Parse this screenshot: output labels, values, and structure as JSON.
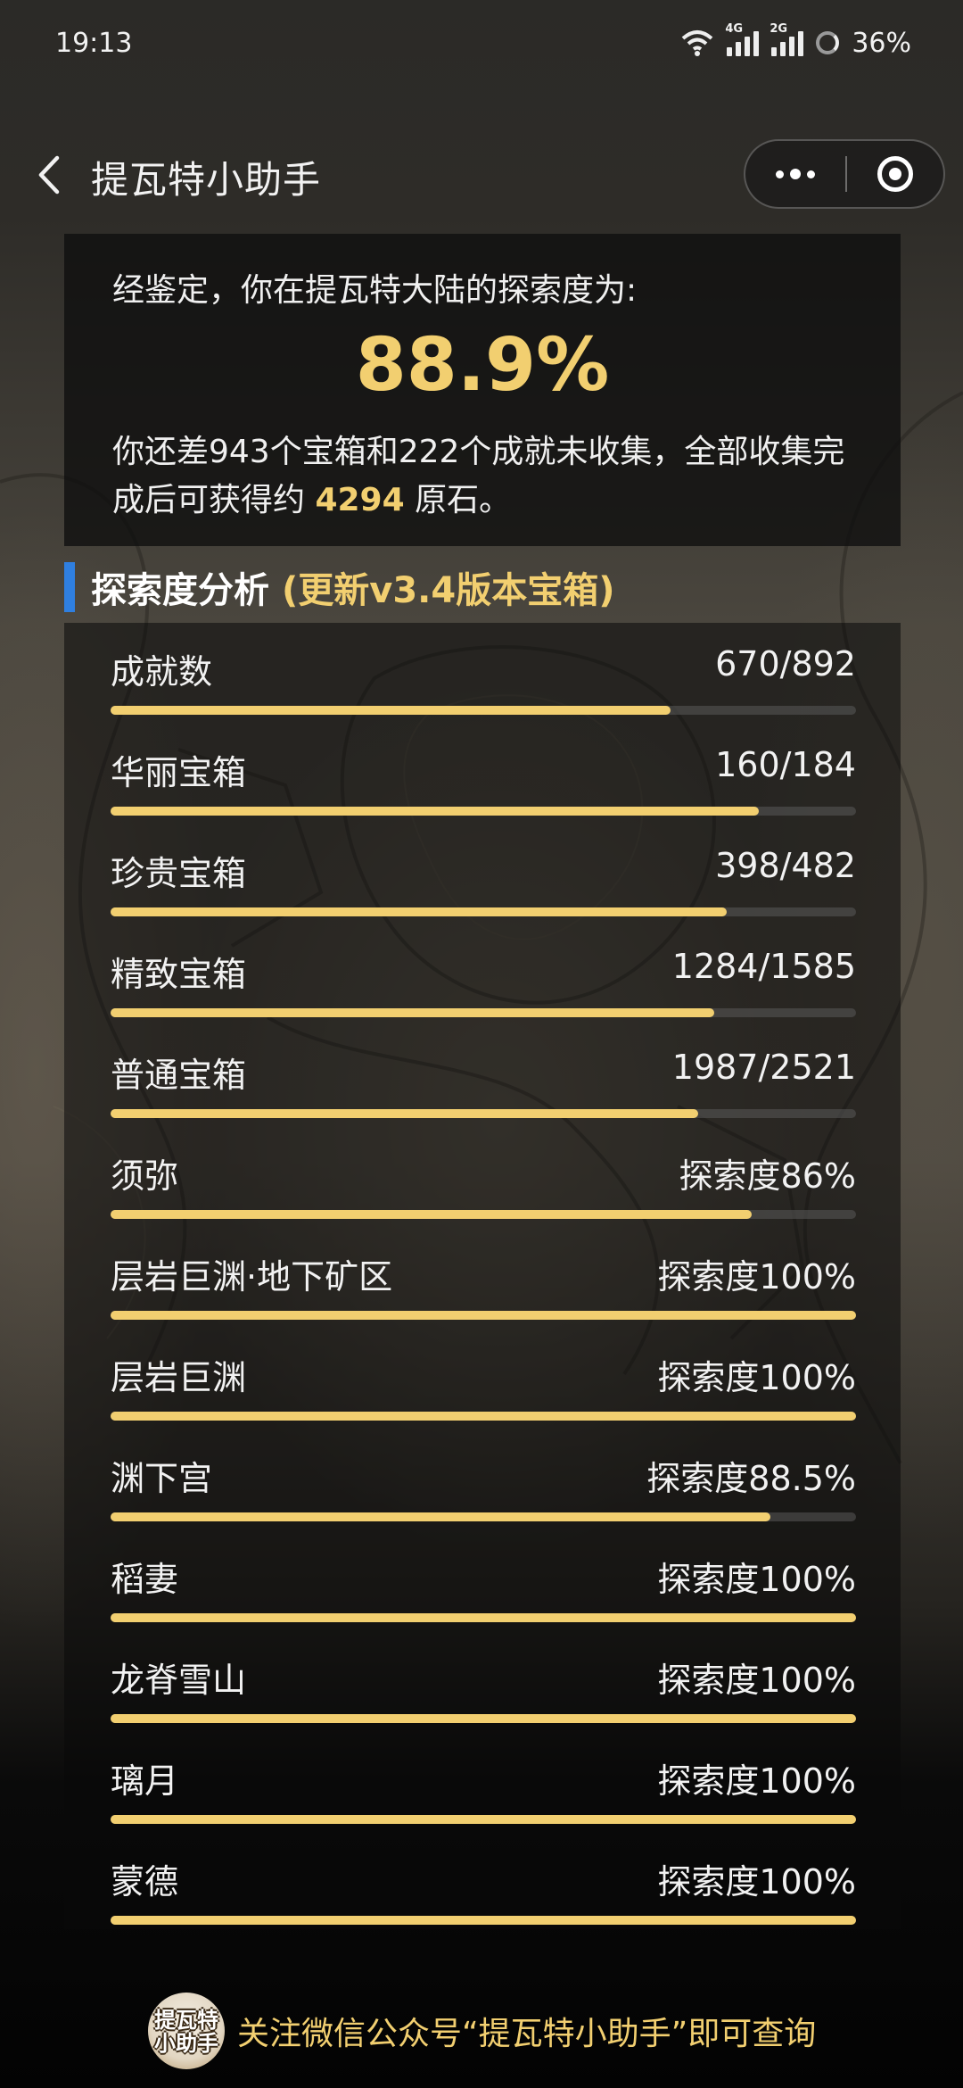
{
  "status_bar": {
    "time": "19:13",
    "signal1_tag": "4G",
    "signal2_tag": "2G",
    "battery": "36%"
  },
  "nav": {
    "title": "提瓦特小助手"
  },
  "summary": {
    "intro": "经鉴定，你在提瓦特大陆的探索度为:",
    "percent": "88.9%",
    "desc_part1": "你还差943个宝箱和222个成就未收集，全部收集完成后可获得约 ",
    "primogems": "4294",
    "desc_part2": " 原石。"
  },
  "section": {
    "title": "探索度分析",
    "note": "(更新v3.4版本宝箱)"
  },
  "stats": [
    {
      "label": "成就数",
      "value": "670/892",
      "progress": 0.751
    },
    {
      "label": "华丽宝箱",
      "value": "160/184",
      "progress": 0.87
    },
    {
      "label": "珍贵宝箱",
      "value": "398/482",
      "progress": 0.826
    },
    {
      "label": "精致宝箱",
      "value": "1284/1585",
      "progress": 0.81
    },
    {
      "label": "普通宝箱",
      "value": "1987/2521",
      "progress": 0.788
    },
    {
      "label": "须弥",
      "value": "探索度86%",
      "progress": 0.86
    },
    {
      "label": "层岩巨渊·地下矿区",
      "value": "探索度100%",
      "progress": 1.0
    },
    {
      "label": "层岩巨渊",
      "value": "探索度100%",
      "progress": 1.0
    },
    {
      "label": "渊下宫",
      "value": "探索度88.5%",
      "progress": 0.885
    },
    {
      "label": "稻妻",
      "value": "探索度100%",
      "progress": 1.0
    },
    {
      "label": "龙脊雪山",
      "value": "探索度100%",
      "progress": 1.0
    },
    {
      "label": "璃月",
      "value": "探索度100%",
      "progress": 1.0
    },
    {
      "label": "蒙德",
      "value": "探索度100%",
      "progress": 1.0
    }
  ],
  "footer": {
    "logo_line1": "提瓦特",
    "logo_line2": "小助手",
    "text": "关注微信公众号“提瓦特小助手”即可查询"
  },
  "colors": {
    "accent": "#f2cf70",
    "section_bar": "#2f7fe0"
  }
}
